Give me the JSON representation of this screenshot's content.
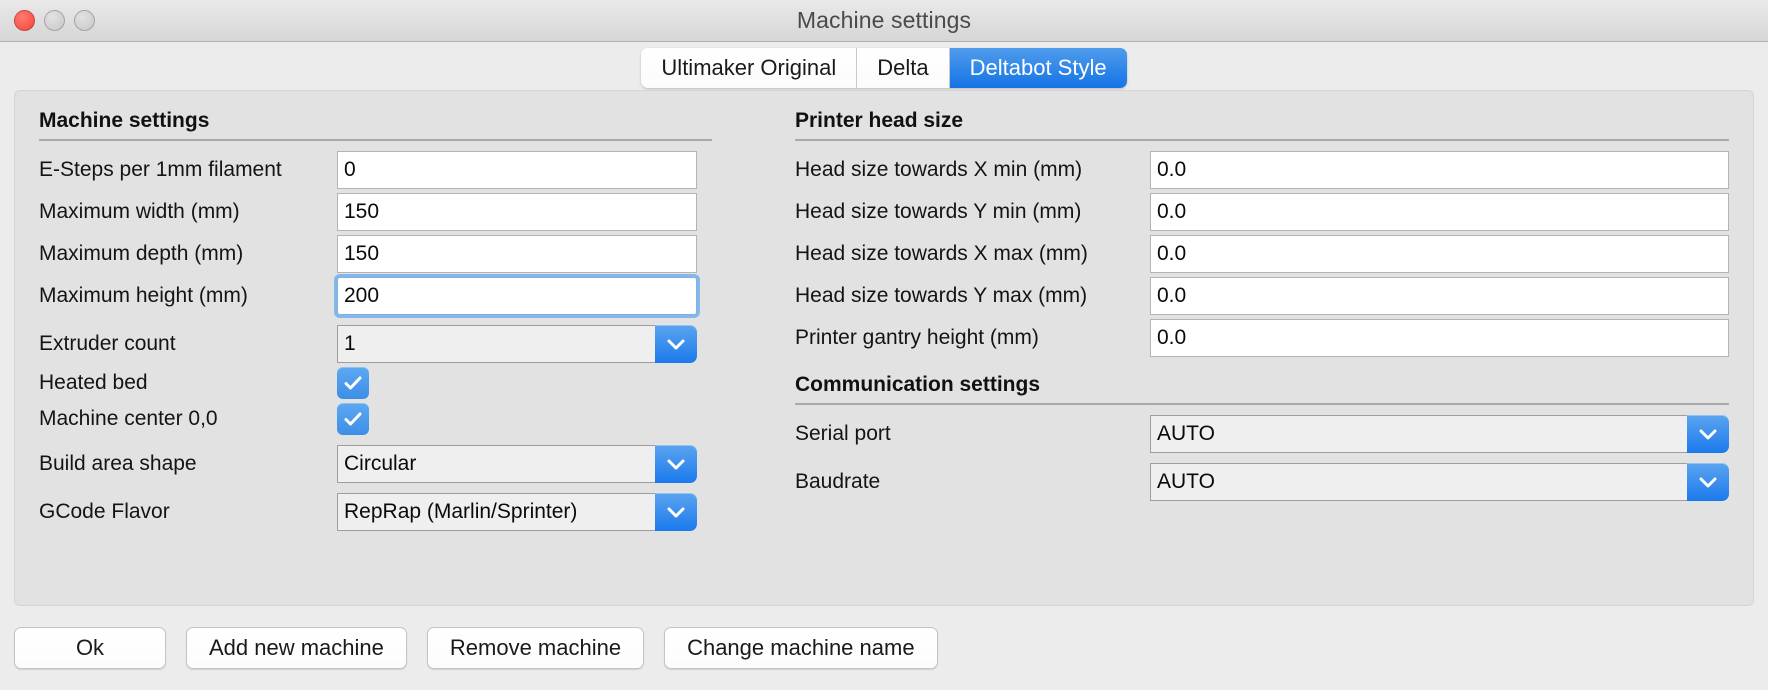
{
  "window": {
    "title": "Machine settings",
    "traffic_lights": [
      {
        "name": "close",
        "state": "active"
      },
      {
        "name": "minimize",
        "state": "disabled"
      },
      {
        "name": "zoom",
        "state": "disabled"
      }
    ]
  },
  "colors": {
    "accent_blue": "#1b79ec",
    "tab_active_top": "#4f9cec",
    "tab_active_bottom": "#1574e5",
    "checkbox_blue": "#4a9bf0",
    "focus_ring": "#85b8ea",
    "panel_bg": "#e2e2e2",
    "window_bg": "#ececec"
  },
  "tabs": [
    {
      "label": "Ultimaker Original",
      "active": false
    },
    {
      "label": "Delta",
      "active": false
    },
    {
      "label": "Deltabot Style",
      "active": true
    }
  ],
  "left_column": {
    "section_title": "Machine settings",
    "rows": [
      {
        "label": "E-Steps per 1mm filament",
        "type": "text",
        "value": "0",
        "focused": false
      },
      {
        "label": "Maximum width (mm)",
        "type": "text",
        "value": "150",
        "focused": false
      },
      {
        "label": "Maximum depth (mm)",
        "type": "text",
        "value": "150",
        "focused": false
      },
      {
        "label": "Maximum height (mm)",
        "type": "text",
        "value": "200",
        "focused": true
      },
      {
        "label": "Extruder count",
        "type": "dropdown",
        "value": "1"
      },
      {
        "label": "Heated bed",
        "type": "checkbox",
        "checked": true
      },
      {
        "label": "Machine center 0,0",
        "type": "checkbox",
        "checked": true
      },
      {
        "label": "Build area shape",
        "type": "dropdown",
        "value": "Circular"
      },
      {
        "label": "GCode Flavor",
        "type": "dropdown",
        "value": "RepRap (Marlin/Sprinter)"
      }
    ]
  },
  "right_column": {
    "head_section_title": "Printer head size",
    "head_rows": [
      {
        "label": "Head size towards X min (mm)",
        "type": "text",
        "value": "0.0"
      },
      {
        "label": "Head size towards Y min (mm)",
        "type": "text",
        "value": "0.0"
      },
      {
        "label": "Head size towards X max (mm)",
        "type": "text",
        "value": "0.0"
      },
      {
        "label": "Head size towards Y max (mm)",
        "type": "text",
        "value": "0.0"
      },
      {
        "label": "Printer gantry height (mm)",
        "type": "text",
        "value": "0.0"
      }
    ],
    "comm_section_title": "Communication settings",
    "comm_rows": [
      {
        "label": "Serial port",
        "type": "dropdown",
        "value": "AUTO"
      },
      {
        "label": "Baudrate",
        "type": "dropdown",
        "value": "AUTO"
      }
    ]
  },
  "buttons": [
    {
      "label": "Ok"
    },
    {
      "label": "Add new machine"
    },
    {
      "label": "Remove machine"
    },
    {
      "label": "Change machine name"
    }
  ]
}
